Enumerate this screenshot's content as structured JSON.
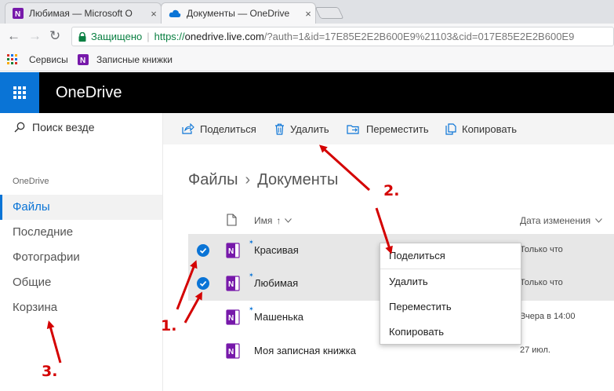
{
  "browser": {
    "tabs": [
      {
        "title": "Любимая — Microsoft O",
        "close": "×"
      },
      {
        "title": "Документы — OneDrive",
        "close": "×"
      }
    ],
    "address": {
      "secure_label": "Защищено",
      "separator": "|",
      "protocol": "https://",
      "host": "onedrive.live.com",
      "path": "/?auth=1&id=17E85E2E2B600E9%21103&cid=017E85E2E2B600E9"
    },
    "bookmarks": [
      {
        "label": "Сервисы",
        "icon": "apps-icon"
      },
      {
        "label": "Записные книжки",
        "icon": "onenote-icon"
      }
    ]
  },
  "app": {
    "brand": "OneDrive",
    "accent": "#0a74d6"
  },
  "leftnav": {
    "search_placeholder": "Поиск везде",
    "caption": "OneDrive",
    "items": [
      {
        "label": "Файлы",
        "active": true
      },
      {
        "label": "Последние"
      },
      {
        "label": "Фотографии"
      },
      {
        "label": "Общие"
      },
      {
        "label": "Корзина"
      }
    ]
  },
  "commands": [
    {
      "label": "Поделиться",
      "icon": "share-icon"
    },
    {
      "label": "Удалить",
      "icon": "trash-icon"
    },
    {
      "label": "Переместить",
      "icon": "move-icon"
    },
    {
      "label": "Копировать",
      "icon": "copy-icon"
    }
  ],
  "breadcrumb": {
    "root": "Файлы",
    "chevron": "›",
    "current": "Документы"
  },
  "table": {
    "col_name": "Имя",
    "col_sort_arrow": "↑",
    "col_date": "Дата изменения",
    "rows": [
      {
        "name": "Красивая",
        "date": "Только что",
        "selected": true
      },
      {
        "name": "Любимая",
        "date": "Только что",
        "selected": true
      },
      {
        "name": "Машенька",
        "date": "Вчера в 14:00",
        "selected": false
      },
      {
        "name": "Моя записная книжка",
        "date": "27 июл.",
        "selected": false
      }
    ]
  },
  "context_menu": {
    "items": [
      "Поделиться",
      "Удалить",
      "Переместить",
      "Копировать"
    ]
  },
  "annotations": {
    "labels": [
      "1.",
      "2.",
      "3."
    ],
    "color": "#d40000"
  }
}
